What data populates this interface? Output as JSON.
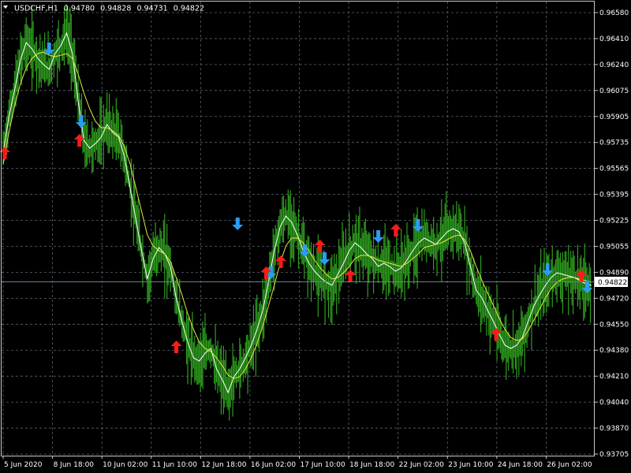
{
  "header": {
    "symbol": "USDCHF,H1",
    "open": "0.94780",
    "high": "0.94828",
    "low": "0.94731",
    "close": "0.94822"
  },
  "current_price_label": "0.94822",
  "colors": {
    "background": "#000000",
    "candles": "#2e9e1e",
    "ma_white": "#ffffff",
    "ma_yellow": "#e8e840",
    "grid": "#5a6470",
    "arrow_down": "#2a9df4",
    "arrow_up": "#ff1a1a",
    "price_line": "#6e7e92"
  },
  "icons": {
    "dropdown": "triangle-down-icon",
    "buy": "up-arrow-icon",
    "sell": "down-arrow-icon"
  },
  "chart_data": {
    "type": "line",
    "ylim": [
      0.937,
      0.9658
    ],
    "price_ticks": [
      "0.96580",
      "0.96410",
      "0.96240",
      "0.96075",
      "0.95905",
      "0.95735",
      "0.95565",
      "0.95395",
      "0.95225",
      "0.95055",
      "0.94890",
      "0.94720",
      "0.94550",
      "0.94380",
      "0.94210",
      "0.94040",
      "0.93870",
      "0.93705"
    ],
    "time_ticks": [
      "5 Jun 2020",
      "8 Jun 18:00",
      "10 Jun 02:00",
      "11 Jun 10:00",
      "12 Jun 18:00",
      "16 Jun 02:00",
      "17 Jun 10:00",
      "18 Jun 18:00",
      "22 Jun 02:00",
      "23 Jun 10:00",
      "24 Jun 18:00",
      "26 Jun 02:00"
    ],
    "series": [
      {
        "values": [
          0.9562,
          0.9585,
          0.9602,
          0.9621,
          0.9632,
          0.9628,
          0.9622,
          0.9618,
          0.9615,
          0.9625,
          0.963,
          0.9638,
          0.9625,
          0.9595,
          0.957,
          0.9565,
          0.9568,
          0.9572,
          0.958,
          0.9575,
          0.9572,
          0.956,
          0.954,
          0.952,
          0.95,
          0.9482,
          0.9495,
          0.9502,
          0.9498,
          0.949,
          0.947,
          0.9455,
          0.9442,
          0.9432,
          0.943,
          0.9435,
          0.9438,
          0.9425,
          0.9418,
          0.941,
          0.942,
          0.9425,
          0.9432,
          0.944,
          0.945,
          0.9462,
          0.948,
          0.95,
          0.9515,
          0.9522,
          0.9518,
          0.951,
          0.95,
          0.9492,
          0.9487,
          0.9483,
          0.948,
          0.9478,
          0.9485,
          0.9492,
          0.95,
          0.9505,
          0.9502,
          0.9498,
          0.9495,
          0.949,
          0.9492,
          0.949,
          0.9487,
          0.9489,
          0.9494,
          0.95,
          0.9505,
          0.9508,
          0.9506,
          0.9504,
          0.9508,
          0.9512,
          0.9514,
          0.9512,
          0.9505,
          0.949,
          0.9475,
          0.947,
          0.9462,
          0.9455,
          0.9447,
          0.944,
          0.9438,
          0.944,
          0.9445,
          0.9455,
          0.9465,
          0.9472,
          0.9478,
          0.9483,
          0.9486,
          0.9485,
          0.9484,
          0.9483,
          0.9481,
          0.9479,
          0.9478
        ]
      },
      {
        "values": [
          0.9555,
          0.9575,
          0.9592,
          0.9606,
          0.9616,
          0.9622,
          0.9625,
          0.9626,
          0.9624,
          0.9623,
          0.9624,
          0.9625,
          0.9622,
          0.9612,
          0.96,
          0.959,
          0.9582,
          0.9578,
          0.9578,
          0.9576,
          0.9573,
          0.9566,
          0.9555,
          0.954,
          0.9525,
          0.951,
          0.9503,
          0.95,
          0.9498,
          0.9493,
          0.9483,
          0.9472,
          0.946,
          0.945,
          0.9442,
          0.9438,
          0.9436,
          0.9432,
          0.9427,
          0.9421,
          0.9419,
          0.942,
          0.9425,
          0.9432,
          0.9441,
          0.9452,
          0.9465,
          0.9478,
          0.9492,
          0.9503,
          0.9508,
          0.9508,
          0.9505,
          0.95,
          0.9494,
          0.9489,
          0.9485,
          0.9482,
          0.9483,
          0.9486,
          0.949,
          0.9495,
          0.9497,
          0.9497,
          0.9496,
          0.9494,
          0.9493,
          0.9492,
          0.9491,
          0.949,
          0.9492,
          0.9495,
          0.9498,
          0.9502,
          0.9503,
          0.9504,
          0.9505,
          0.9507,
          0.9509,
          0.951,
          0.9507,
          0.95,
          0.949,
          0.9481,
          0.9473,
          0.9465,
          0.9457,
          0.945,
          0.9445,
          0.9443,
          0.9444,
          0.9449,
          0.9456,
          0.9463,
          0.947,
          0.9476,
          0.948,
          0.9482,
          0.9483,
          0.9483,
          0.9482,
          0.9481,
          0.948
        ]
      }
    ],
    "signals": [
      {
        "type": "buy",
        "x": 0.0,
        "price": 0.9561
      },
      {
        "type": "sell",
        "x": 0.076,
        "price": 0.9629
      },
      {
        "type": "sell",
        "x": 0.131,
        "price": 0.9583
      },
      {
        "type": "buy",
        "x": 0.128,
        "price": 0.9569
      },
      {
        "type": "buy",
        "x": 0.294,
        "price": 0.9438
      },
      {
        "type": "sell",
        "x": 0.399,
        "price": 0.9518
      },
      {
        "type": "sell",
        "x": 0.456,
        "price": 0.9487
      },
      {
        "type": "buy",
        "x": 0.448,
        "price": 0.9485
      },
      {
        "type": "buy",
        "x": 0.473,
        "price": 0.9492
      },
      {
        "type": "sell",
        "x": 0.514,
        "price": 0.9501
      },
      {
        "type": "buy",
        "x": 0.54,
        "price": 0.9502
      },
      {
        "type": "sell",
        "x": 0.548,
        "price": 0.9496
      },
      {
        "type": "buy",
        "x": 0.592,
        "price": 0.9483
      },
      {
        "type": "sell",
        "x": 0.64,
        "price": 0.951
      },
      {
        "type": "buy",
        "x": 0.67,
        "price": 0.9512
      },
      {
        "type": "sell",
        "x": 0.708,
        "price": 0.9517
      },
      {
        "type": "buy",
        "x": 0.842,
        "price": 0.9446
      },
      {
        "type": "sell",
        "x": 0.93,
        "price": 0.9489
      },
      {
        "type": "buy",
        "x": 0.988,
        "price": 0.9483
      },
      {
        "type": "sell",
        "x": 0.998,
        "price": 0.9478
      }
    ]
  }
}
